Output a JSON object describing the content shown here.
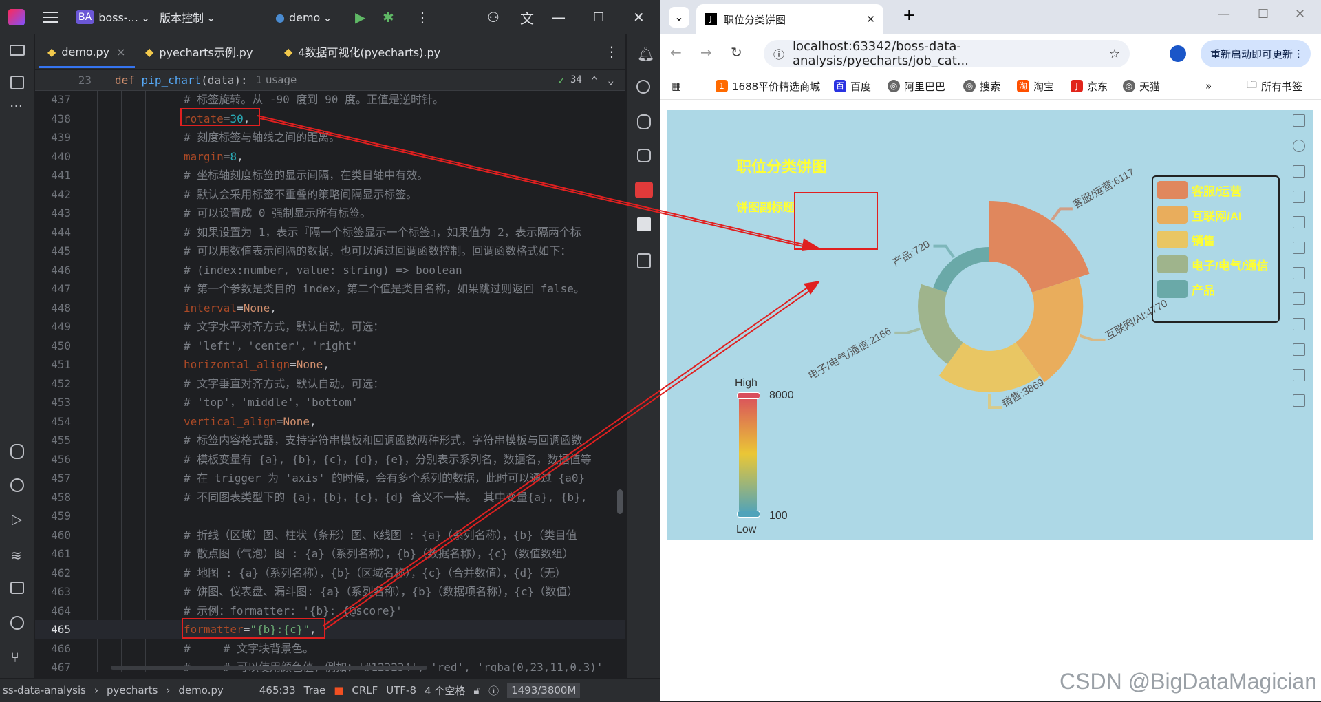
{
  "ide": {
    "project": "boss-...",
    "project_badge": "BA",
    "vcs": "版本控制",
    "run_config": "demo",
    "tabs": [
      {
        "label": "demo.py"
      },
      {
        "label": "pyecharts示例.py"
      },
      {
        "label": "4数据可视化(pyecharts).py"
      }
    ],
    "sticky": {
      "line": "23",
      "code": "def pip_chart(data):",
      "usages": "1 usage",
      "checks": "34"
    },
    "lines": [
      {
        "n": "437",
        "t": "# 标签旋转。从 -90 度到 90 度。正值是逆时针。"
      },
      {
        "n": "438",
        "t": "rotate=30,"
      },
      {
        "n": "439",
        "t": "# 刻度标签与轴线之间的距离。"
      },
      {
        "n": "440",
        "t": "margin=8,"
      },
      {
        "n": "441",
        "t": "# 坐标轴刻度标签的显示间隔，在类目轴中有效。"
      },
      {
        "n": "442",
        "t": "# 默认会采用标签不重叠的策略间隔显示标签。"
      },
      {
        "n": "443",
        "t": "# 可以设置成 0 强制显示所有标签。"
      },
      {
        "n": "444",
        "t": "# 如果设置为 1，表示『隔一个标签显示一个标签』，如果值为 2，表示隔两个标"
      },
      {
        "n": "445",
        "t": "# 可以用数值表示间隔的数据，也可以通过回调函数控制。回调函数格式如下："
      },
      {
        "n": "446",
        "t": "# (index:number, value: string) => boolean"
      },
      {
        "n": "447",
        "t": "# 第一个参数是类目的 index，第二个值是类目名称，如果跳过则返回 false。"
      },
      {
        "n": "448",
        "t": "interval=None,"
      },
      {
        "n": "449",
        "t": "# 文字水平对齐方式，默认自动。可选："
      },
      {
        "n": "450",
        "t": "# 'left'，'center'，'right'"
      },
      {
        "n": "451",
        "t": "horizontal_align=None,"
      },
      {
        "n": "452",
        "t": "# 文字垂直对齐方式，默认自动。可选："
      },
      {
        "n": "453",
        "t": "# 'top'，'middle'，'bottom'"
      },
      {
        "n": "454",
        "t": "vertical_align=None,"
      },
      {
        "n": "455",
        "t": "# 标签内容格式器，支持字符串模板和回调函数两种形式，字符串模板与回调函数"
      },
      {
        "n": "456",
        "t": "# 模板变量有 {a}, {b}，{c}，{d}，{e}，分别表示系列名，数据名，数据值等"
      },
      {
        "n": "457",
        "t": "# 在 trigger 为 'axis' 的时候，会有多个系列的数据，此时可以通过 {a0}"
      },
      {
        "n": "458",
        "t": "# 不同图表类型下的 {a}，{b}，{c}，{d} 含义不一样。 其中变量{a}, {b},"
      },
      {
        "n": "459",
        "t": ""
      },
      {
        "n": "460",
        "t": "# 折线（区域）图、柱状（条形）图、K线图 : {a}（系列名称），{b}（类目值"
      },
      {
        "n": "461",
        "t": "# 散点图（气泡）图 : {a}（系列名称），{b}（数据名称），{c}（数值数组）"
      },
      {
        "n": "462",
        "t": "# 地图 : {a}（系列名称），{b}（区域名称），{c}（合并数值），{d}（无）"
      },
      {
        "n": "463",
        "t": "# 饼图、仪表盘、漏斗图: {a}（系列名称），{b}（数据项名称），{c}（数值）"
      },
      {
        "n": "464",
        "t": "# 示例：formatter: '{b}: {@score}'"
      },
      {
        "n": "465",
        "t": "formatter=\"{b}:{c}\","
      },
      {
        "n": "466",
        "t": "#     # 文字块背景色。"
      },
      {
        "n": "467",
        "t": "#     # 可以使用颜色值，例如：'#123234', 'red', 'rgba(0,23,11,0.3)'"
      }
    ],
    "status": {
      "breadcrumb": [
        "ss-data-analysis",
        "pyecharts",
        "demo.py"
      ],
      "position": "465:33",
      "trae": "Trae",
      "line_sep": "CRLF",
      "encoding": "UTF-8",
      "indent": "4 个空格",
      "memory": "1493/3800M"
    }
  },
  "browser": {
    "tab_title": "职位分类饼图",
    "url": "localhost:63342/boss-data-analysis/pyecharts/job_cat...",
    "update_button": "重新启动即可更新",
    "bookmarks": [
      "1688平价精选商城",
      "百度",
      "阿里巴巴",
      "搜索",
      "淘宝",
      "京东",
      "天猫"
    ],
    "all_bookmarks": "所有书签"
  },
  "chart_data": {
    "type": "pie",
    "title": "职位分类饼图",
    "subtitle": "饼图副标题",
    "categories": [
      "客服/运营",
      "互联网/AI",
      "销售",
      "电子/电气/通信",
      "产品"
    ],
    "values": [
      6117,
      4770,
      3869,
      2166,
      720
    ],
    "colors": [
      "#e0875d",
      "#e9ad5c",
      "#e9c663",
      "#9fb48c",
      "#6aa9a8"
    ],
    "label_formatter": "{b}:{c}",
    "radius": [
      "40%",
      "75%"
    ],
    "rose_type": "radius",
    "legend_position": "right",
    "visual_map": {
      "min": 100,
      "max": 8000,
      "high_text": "High",
      "low_text": "Low"
    }
  },
  "watermark": "CSDN @BigDataMagician"
}
